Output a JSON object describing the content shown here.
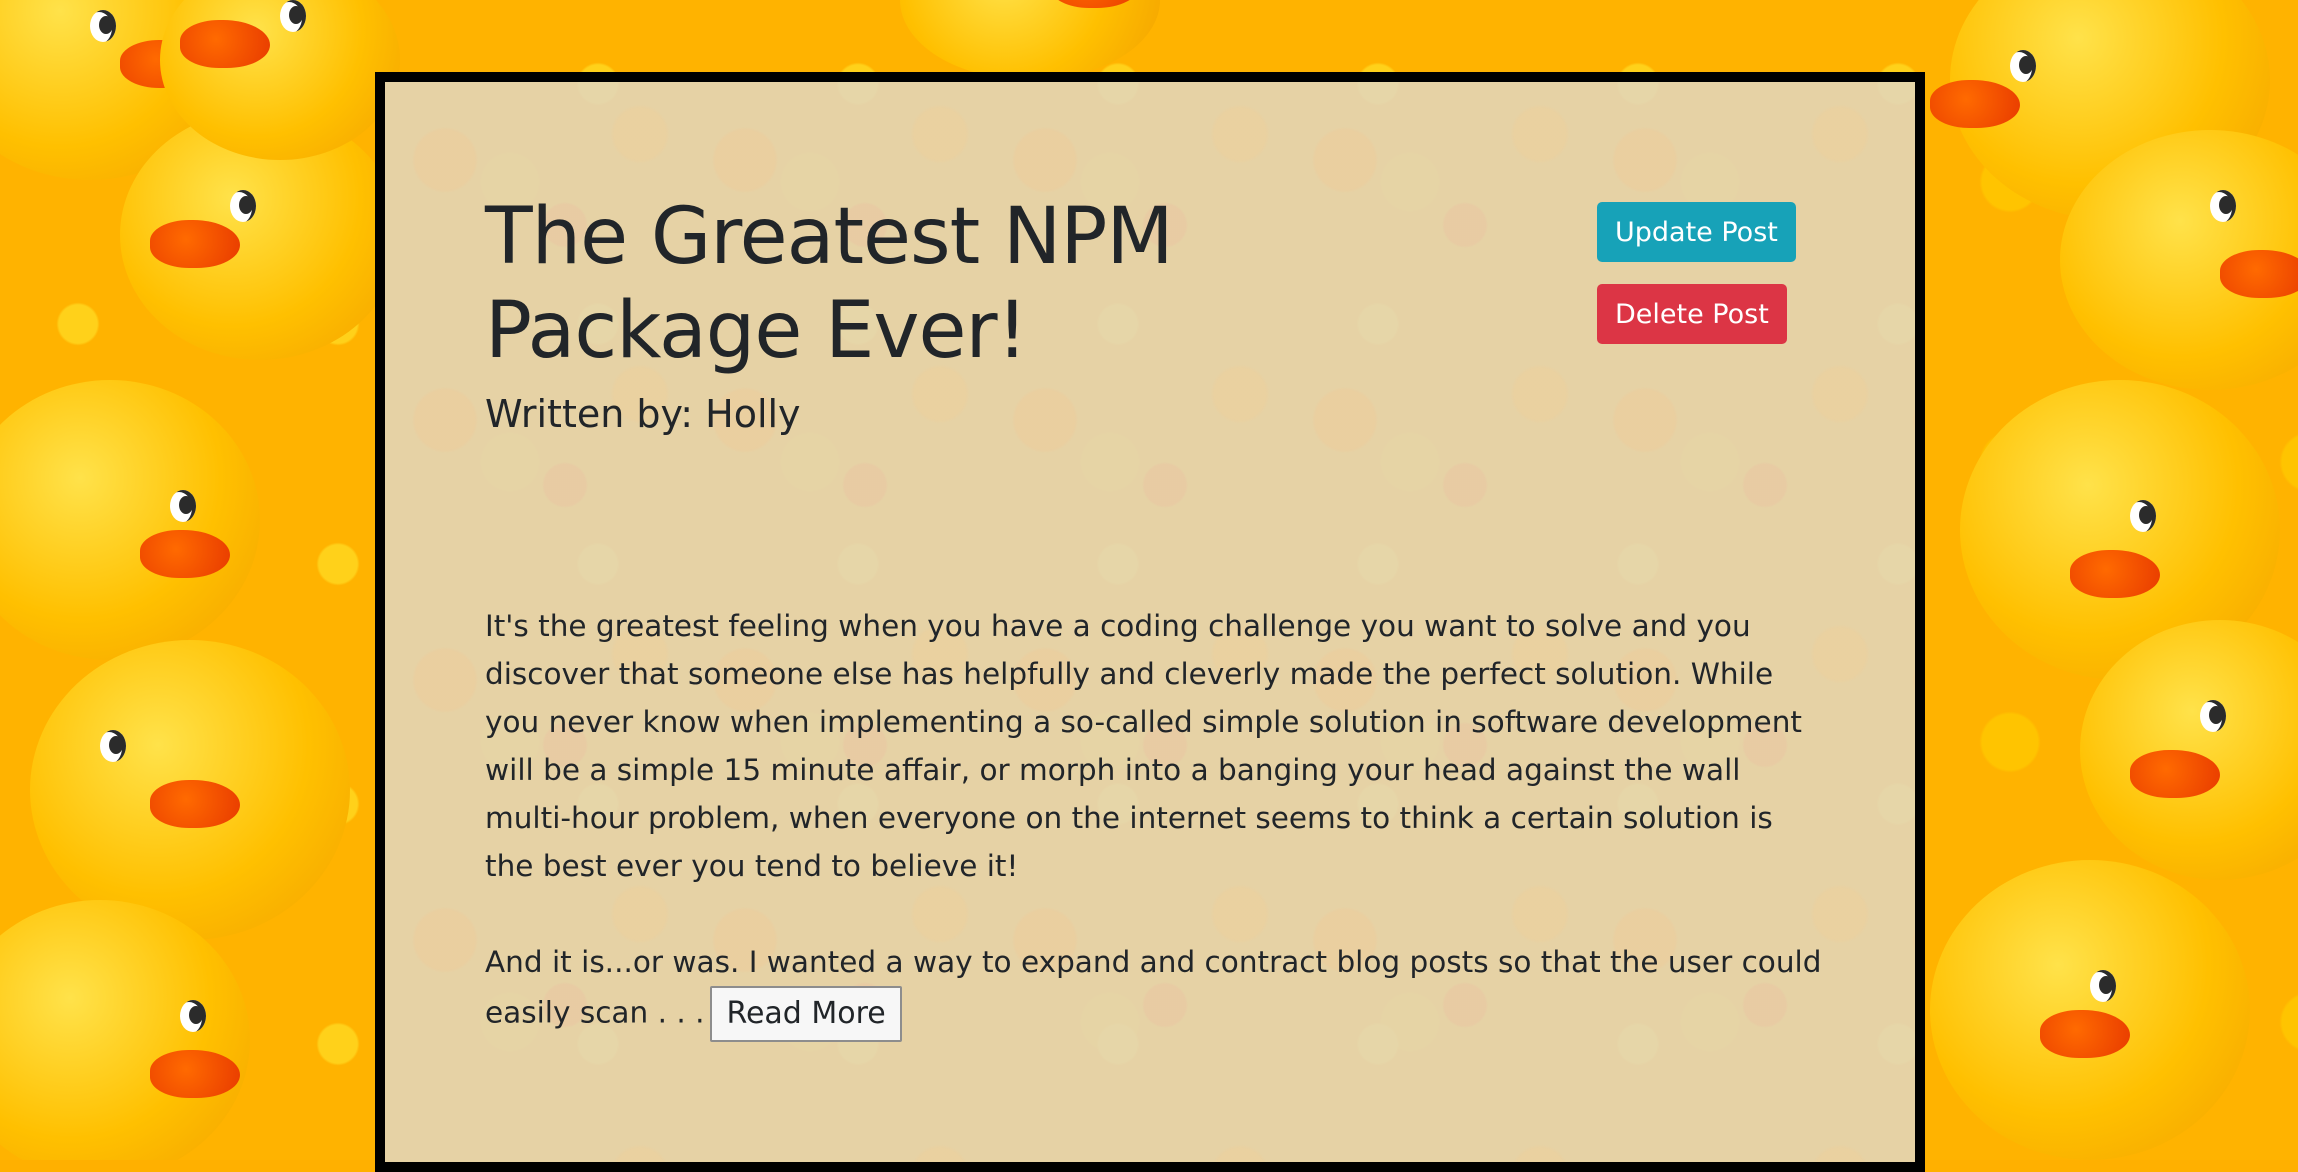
{
  "post": {
    "title": "The Greatest NPM Package Ever!",
    "author_line": "Written by: Holly",
    "paragraph_1": "It's the greatest feeling when you have a coding challenge you want to solve and you discover that someone else has helpfully and cleverly made the perfect solution. While you never know when implementing a so-called simple solution in software development will be a simple 15 minute affair, or morph into a banging your head against the wall multi-hour problem, when everyone on the internet seems to think a certain solution is the best ever you tend to believe it!",
    "paragraph_2": "And it is...or was. I wanted a way to expand and contract blog posts so that the user could easily scan . . .",
    "read_more_label": "Read More"
  },
  "actions": {
    "update_label": "Update Post",
    "delete_label": "Delete Post"
  },
  "colors": {
    "update": "#17a2b8",
    "delete": "#dc3545",
    "panel_border": "#000000",
    "text": "#212529"
  }
}
